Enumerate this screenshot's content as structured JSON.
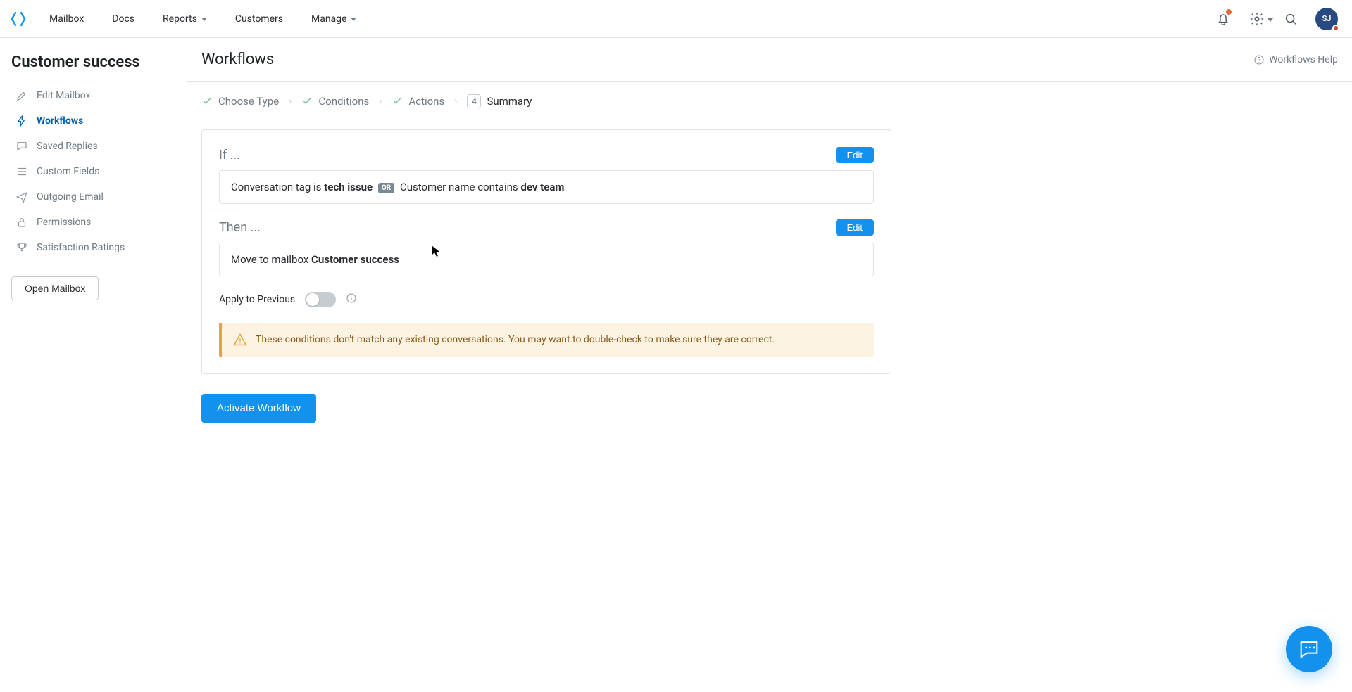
{
  "nav": {
    "mailbox": "Mailbox",
    "docs": "Docs",
    "reports": "Reports",
    "customers": "Customers",
    "manage": "Manage"
  },
  "profile": {
    "initials": "SJ"
  },
  "sidebar": {
    "title": "Customer success",
    "items": {
      "edit_mailbox": "Edit Mailbox",
      "workflows": "Workflows",
      "saved_replies": "Saved Replies",
      "custom_fields": "Custom Fields",
      "outgoing_email": "Outgoing Email",
      "permissions": "Permissions",
      "satisfaction_ratings": "Satisfaction Ratings"
    },
    "open_mailbox": "Open Mailbox"
  },
  "main": {
    "title": "Workflows",
    "help_link": "Workflows Help",
    "steps": {
      "choose_type": "Choose Type",
      "conditions": "Conditions",
      "actions": "Actions",
      "summary_num": "4",
      "summary": "Summary"
    },
    "if": {
      "heading": "If ...",
      "edit": "Edit",
      "rule_prefix": "Conversation tag is ",
      "rule_bold1": "tech issue",
      "rule_or": "OR",
      "rule_mid": " Customer name contains ",
      "rule_bold2": "dev team"
    },
    "then": {
      "heading": "Then ...",
      "edit": "Edit",
      "rule_prefix": "Move to mailbox ",
      "rule_bold": "Customer success"
    },
    "apply_previous": "Apply to Previous",
    "warning": "These conditions don't match any existing conversations. You may want to double-check to make sure they are correct.",
    "activate": "Activate Workflow"
  }
}
